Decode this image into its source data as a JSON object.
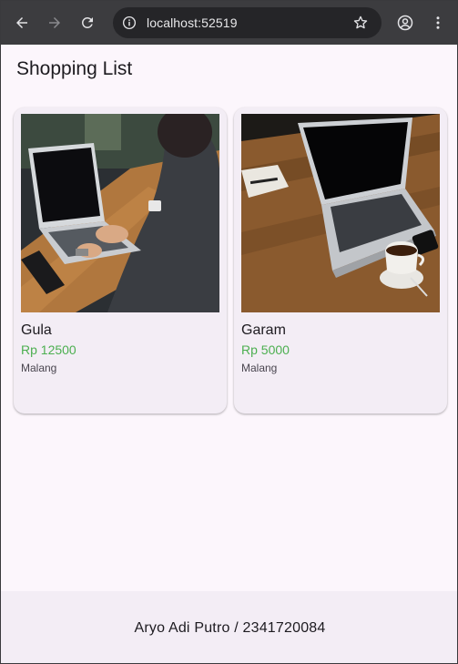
{
  "browser": {
    "url": "localhost:52519",
    "icons": [
      "back-icon",
      "forward-icon",
      "reload-icon",
      "site-info-icon",
      "bookmark-star-icon",
      "profile-icon",
      "menu-dots-icon"
    ]
  },
  "app": {
    "title": "Shopping List",
    "items": [
      {
        "name": "Gula",
        "price": "Rp 12500",
        "city": "Malang",
        "image": "man typing on laptop at wooden table"
      },
      {
        "name": "Garam",
        "price": "Rp 5000",
        "city": "Malang",
        "image": "laptop with coffee cup on wooden table"
      }
    ],
    "footer": "Aryo Adi Putro / 2341720084"
  },
  "colors": {
    "price": "#4caf50",
    "background": "#fcf6fc",
    "card": "#f3edf5",
    "footer": "#f3edf5",
    "toolbar": "#3c3c3f"
  }
}
